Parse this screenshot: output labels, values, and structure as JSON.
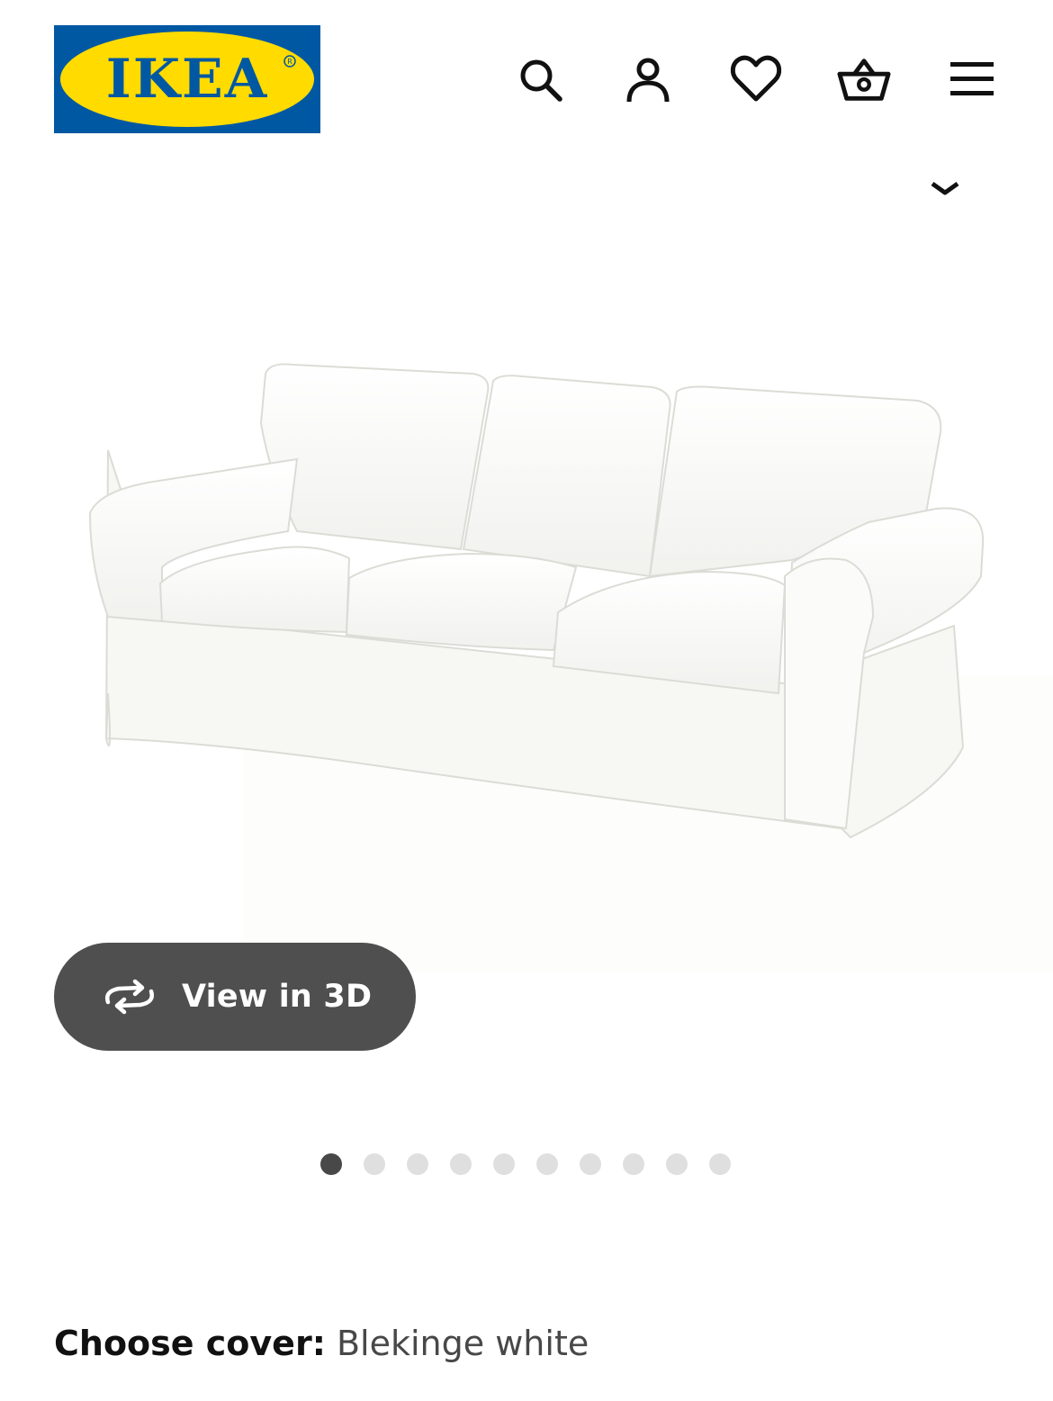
{
  "header": {
    "logo_text": "IKEA",
    "icons": [
      "search-icon",
      "account-icon",
      "heart-icon",
      "basket-icon",
      "menu-icon"
    ]
  },
  "product": {
    "image_subject": "sofa",
    "view_3d_label": "View in 3D",
    "carousel": {
      "total": 10,
      "active": 1
    }
  },
  "cover": {
    "label": "Choose cover:",
    "value": "Blekinge white"
  },
  "colors": {
    "ikea_blue": "#0058a3",
    "ikea_yellow": "#ffdb00",
    "button_dark": "#4f4f4f",
    "dot_active": "#484848",
    "dot_inactive": "#dfdfdf"
  }
}
